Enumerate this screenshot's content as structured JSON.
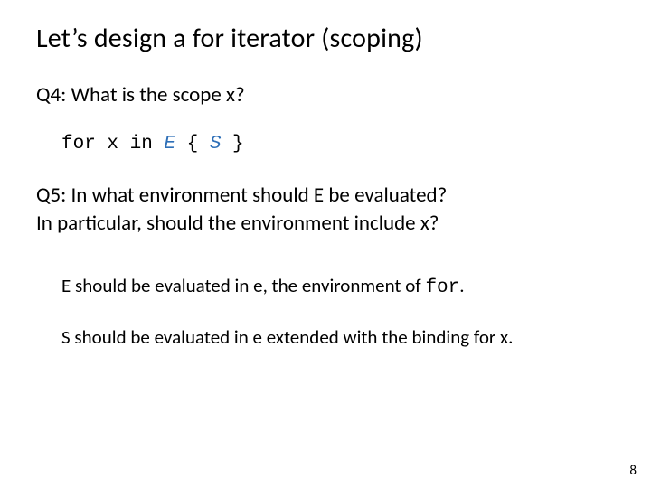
{
  "title": "Let’s design a for iterator (scoping)",
  "q4": "Q4: What is the scope x?",
  "code": {
    "p1": "for x in ",
    "E": "E",
    "p2": " { ",
    "S": "S",
    "p3": " }"
  },
  "q5_line1": "Q5: In what environment should E be evaluated?",
  "q5_line2": "In particular, should the environment include x?",
  "ans1_a": "E should be evaluated in e, the environment of ",
  "ans1_b": "for",
  "ans1_c": ".",
  "ans2": "S should be evaluated in e extended with the binding for x.",
  "page": "8"
}
